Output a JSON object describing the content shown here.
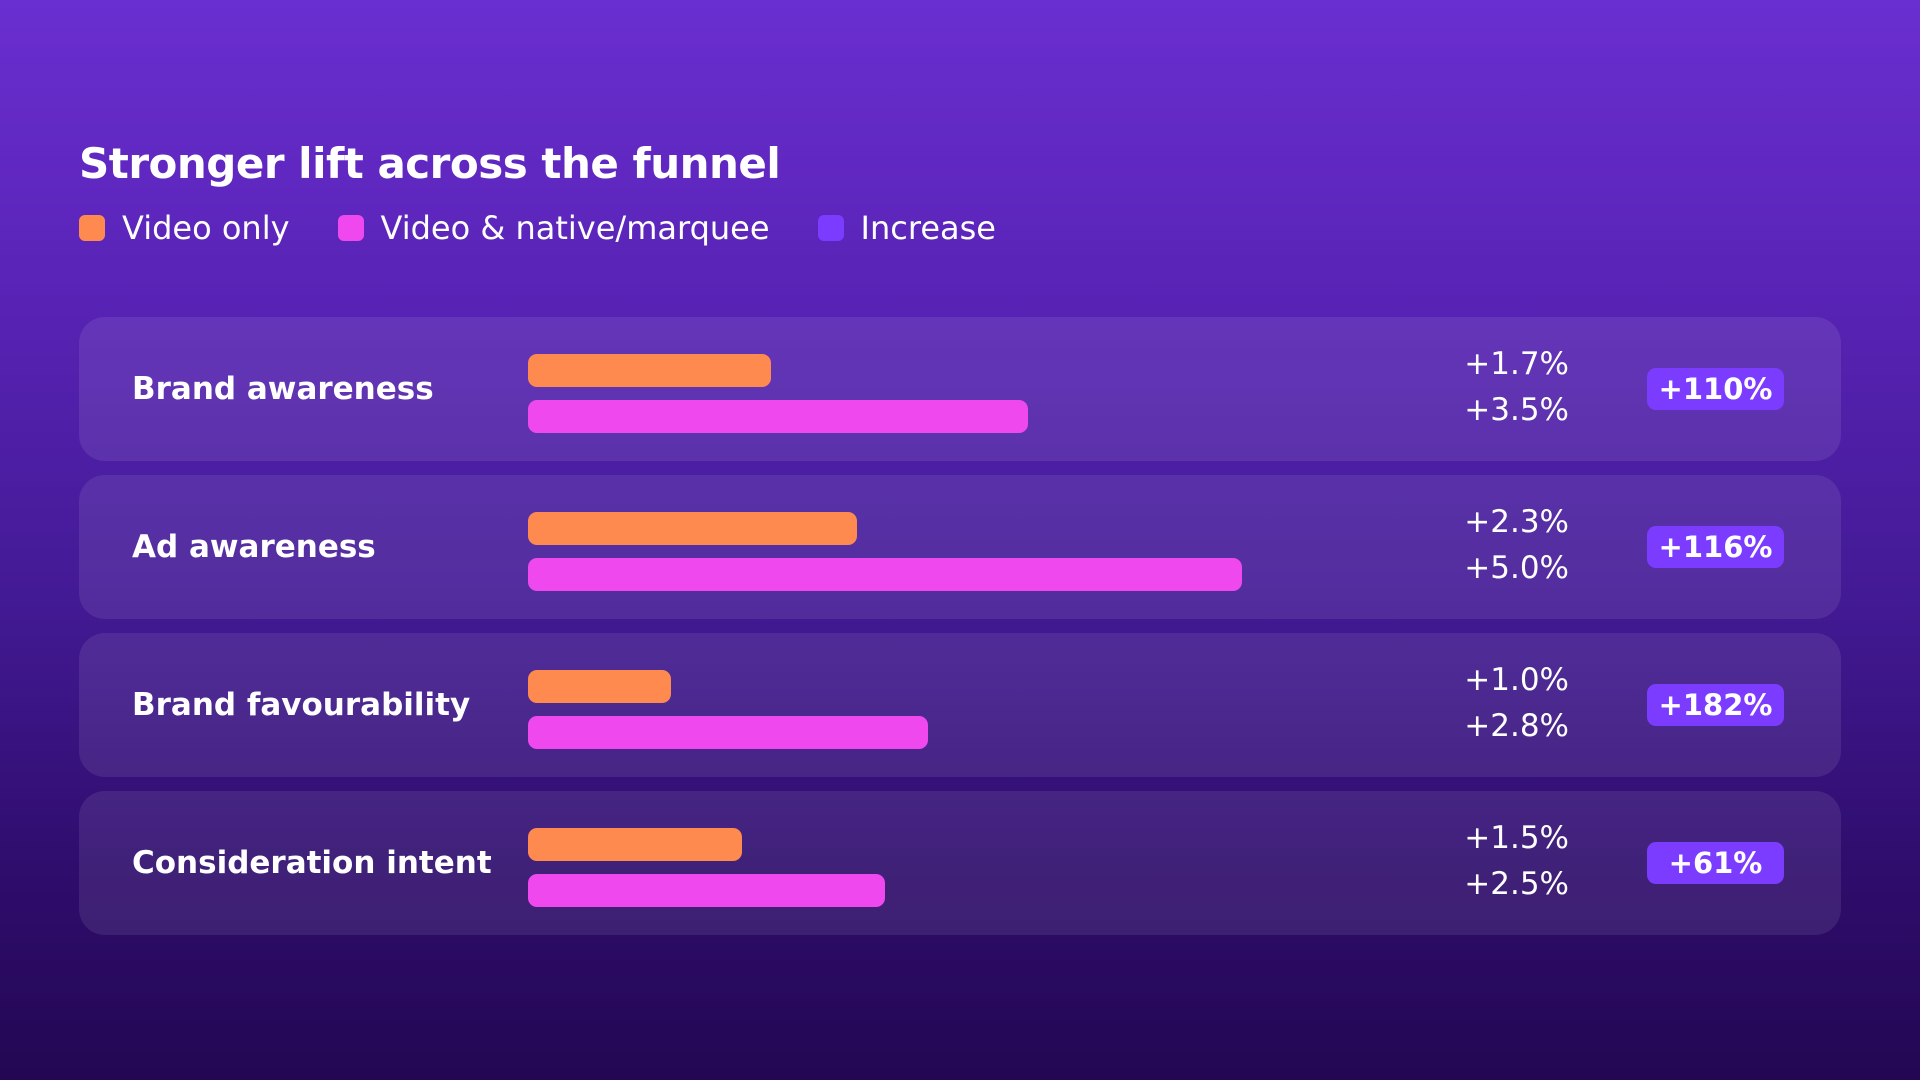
{
  "colors": {
    "video_only": "#ff8a50",
    "video_native": "#ee48ee",
    "increase": "#7b3cff"
  },
  "chart_data": {
    "type": "bar",
    "title": "Stronger lift across the funnel",
    "legend": [
      {
        "label": "Video only",
        "color": "#ff8a50"
      },
      {
        "label": "Video & native/marquee",
        "color": "#ee48ee"
      },
      {
        "label": "Increase",
        "color": "#7b3cff"
      }
    ],
    "categories": [
      "Brand awareness",
      "Ad awareness",
      "Brand favourability",
      "Consideration intent"
    ],
    "series": [
      {
        "name": "Video only",
        "values": [
          1.7,
          2.3,
          1.0,
          1.5
        ],
        "labels": [
          "+1.7%",
          "+2.3%",
          "+1.0%",
          "+1.5%"
        ]
      },
      {
        "name": "Video & native/marquee",
        "values": [
          3.5,
          5.0,
          2.8,
          2.5
        ],
        "labels": [
          "+3.5%",
          "+5.0%",
          "+2.8%",
          "+2.5%"
        ]
      },
      {
        "name": "Increase",
        "labels": [
          "+110%",
          "+116%",
          "+182%",
          "+61%"
        ]
      }
    ],
    "xlim": [
      0,
      7
    ],
    "grid": false,
    "legend_position": "top-left"
  }
}
